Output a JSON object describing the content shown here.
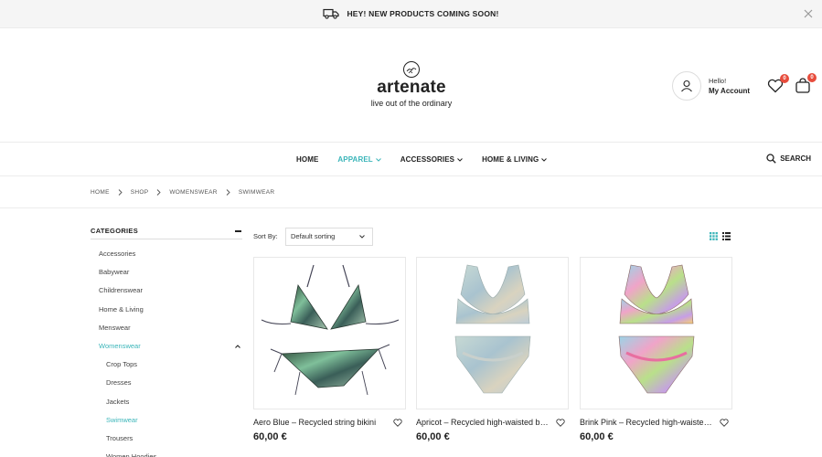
{
  "topbar": {
    "message": "HEY! NEW PRODUCTS COMING SOON!",
    "icon": "truck-icon"
  },
  "header": {
    "brand": "artenate",
    "tagline": "live out of the ordinary",
    "account_hello": "Hello!",
    "account_label": "My Account",
    "wishlist_count": "0",
    "cart_count": "0"
  },
  "nav": {
    "items": [
      {
        "label": "HOME"
      },
      {
        "label": "APPAREL"
      },
      {
        "label": "ACCESSORIES"
      },
      {
        "label": "HOME & LIVING"
      }
    ],
    "search_label": "SEARCH"
  },
  "breadcrumb": [
    "HOME",
    "SHOP",
    "WOMENSWEAR",
    "SWIMWEAR"
  ],
  "sidebar": {
    "title": "CATEGORIES",
    "items": [
      {
        "label": "Accessories"
      },
      {
        "label": "Babywear"
      },
      {
        "label": "Childrenswear"
      },
      {
        "label": "Home & Living"
      },
      {
        "label": "Menswear"
      },
      {
        "label": "Womenswear"
      },
      {
        "label": "Crop Tops"
      },
      {
        "label": "Dresses"
      },
      {
        "label": "Jackets"
      },
      {
        "label": "Swimwear"
      },
      {
        "label": "Trousers"
      },
      {
        "label": "Women Hoodies"
      }
    ]
  },
  "toolbar": {
    "sort_label": "Sort By:",
    "sort_value": "Default sorting"
  },
  "products": [
    {
      "title": "Aero Blue – Recycled string bikini",
      "price": "60,00 €"
    },
    {
      "title": "Apricot – Recycled high-waisted bikini",
      "price": "60,00 €"
    },
    {
      "title": "Brink Pink – Recycled high-waisted bikini",
      "price": "60,00 €"
    }
  ],
  "colors": {
    "accent": "#3ab5b9",
    "badge": "#e74c3c"
  }
}
